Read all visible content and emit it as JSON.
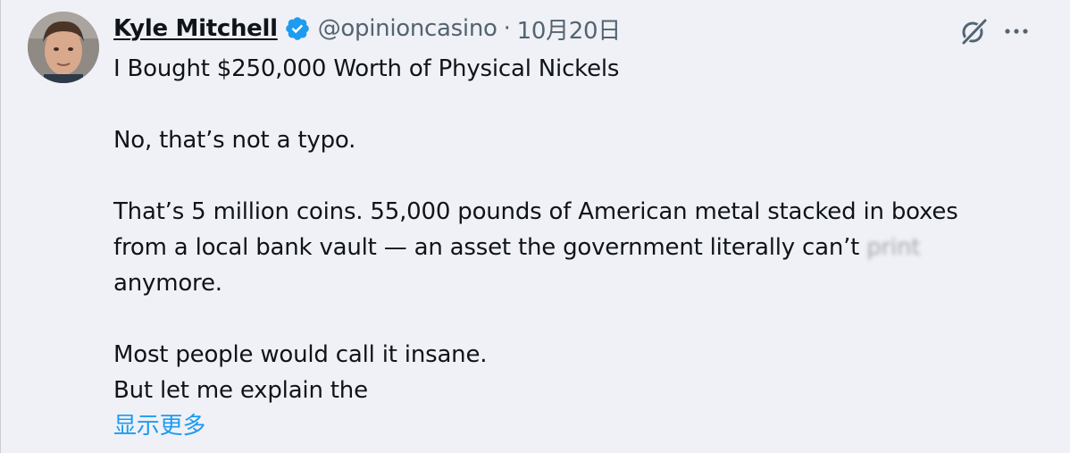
{
  "tweet": {
    "author_name": "Kyle Mitchell",
    "handle": "@opinioncasino",
    "separator": "·",
    "date": "10月20日",
    "line1": "I Bought $250,000 Worth of Physical Nickels",
    "line2": "No, that’s not a typo.",
    "line3": "That’s 5 million coins. 55,000 pounds of American metal stacked in boxes",
    "line4_main": "from a local bank vault — an asset the government literally can’t ",
    "line4_blurred": "print",
    "line5": "anymore.",
    "line6": "Most people would call it insane.",
    "line7": "But let me explain the",
    "show_more": "显示更多"
  },
  "icons": {
    "verified": "verified-badge-icon",
    "grok": "grok-icon",
    "more": "more-options-icon"
  },
  "colors": {
    "background": "#f0f1f7",
    "text": "#0f1419",
    "secondary": "#536471",
    "accent": "#1d9bf0"
  }
}
